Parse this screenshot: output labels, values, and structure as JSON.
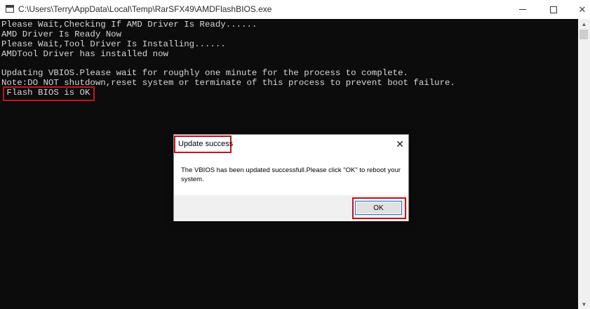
{
  "window": {
    "title": "C:\\Users\\Terry\\AppData\\Local\\Temp\\RarSFX49\\AMDFlashBIOS.exe",
    "icon": "console-app-icon"
  },
  "console": {
    "lines": [
      "Please Wait,Checking If AMD Driver Is Ready......",
      "AMD Driver Is Ready Now",
      "Please Wait,Tool Driver Is Installing......",
      "AMDTool Driver has installed now",
      "",
      "Updating VBIOS.Please wait for roughly one minute for the process to complete.",
      "Note:DO NOT shutdown,reset system or terminate of this process to prevent boot failure.",
      " Flash BIOS is OK"
    ]
  },
  "dialog": {
    "title": "Update success",
    "message": "The VBIOS has been updated successfull.Please click \"OK\" to reboot your system.",
    "ok_label": "OK"
  },
  "colors": {
    "console_bg": "#0c0c0c",
    "console_text": "#d8d8d8",
    "highlight_red": "#c4141d",
    "button_focus": "#0078d7"
  }
}
